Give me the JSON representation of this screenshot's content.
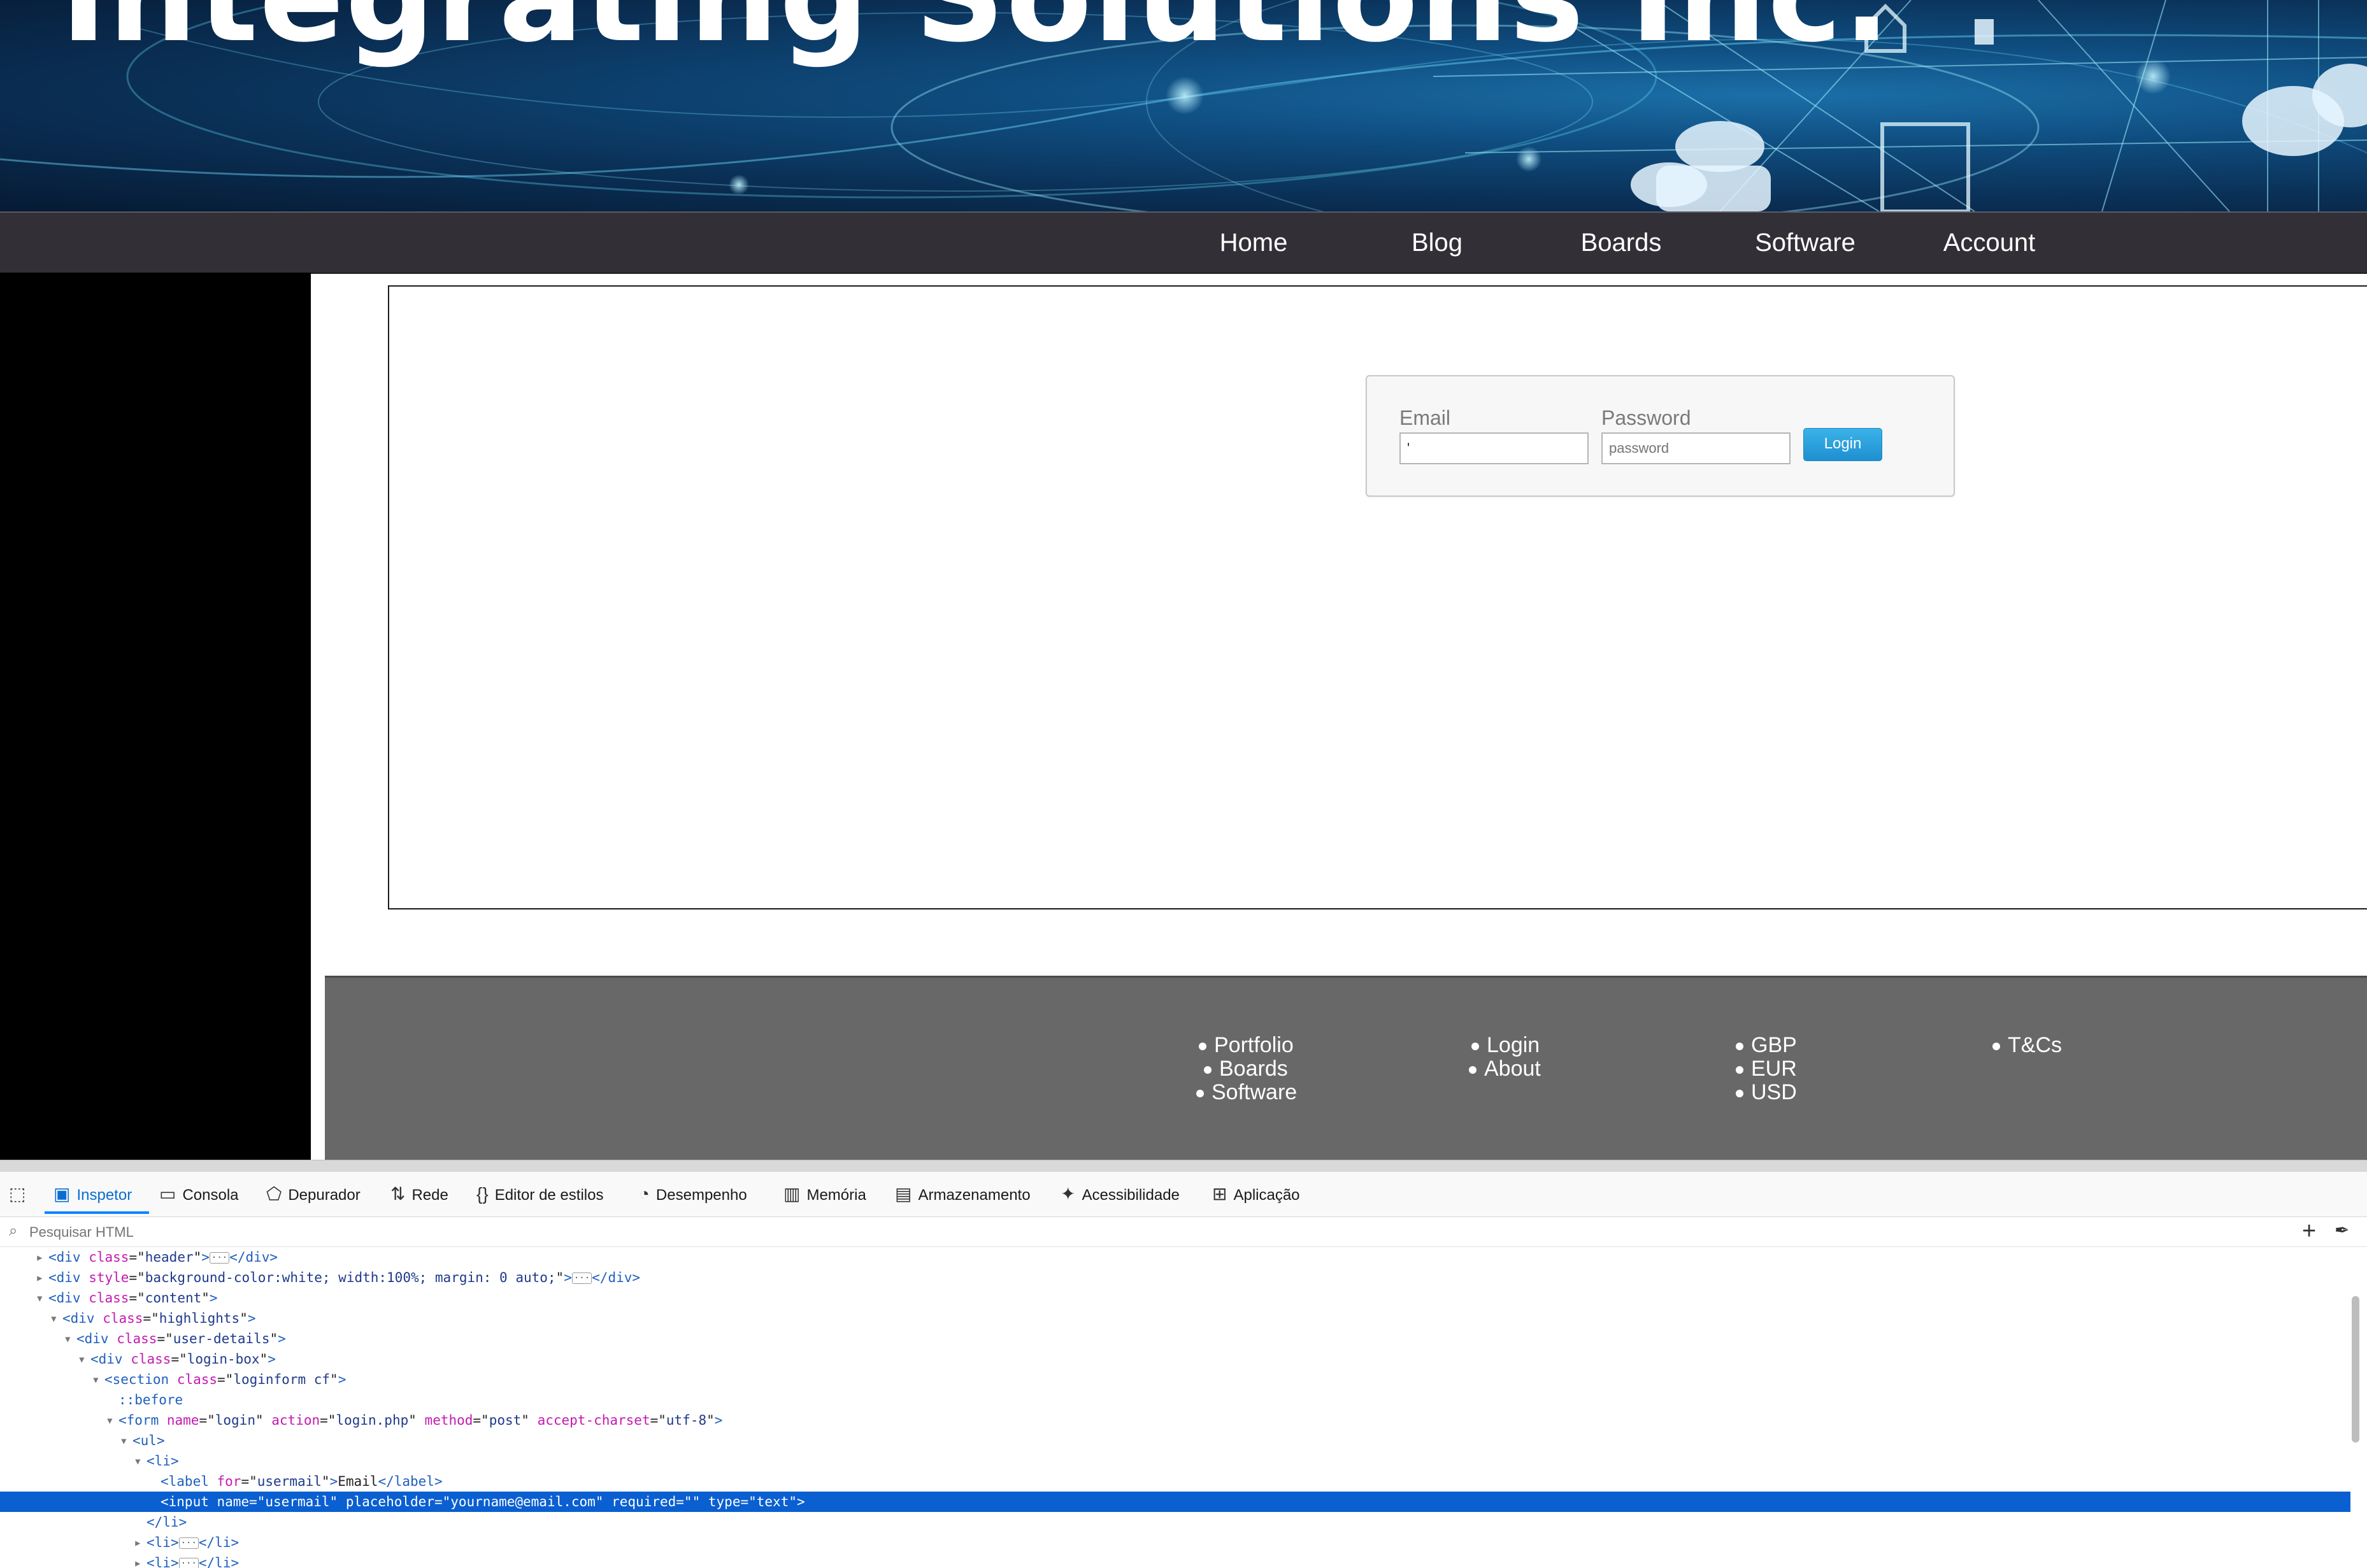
{
  "banner": {
    "title": "Integrating Solutions Inc."
  },
  "nav": {
    "items": [
      "Home",
      "Blog",
      "Boards",
      "Software",
      "Account"
    ]
  },
  "login": {
    "email_label": "Email",
    "email_value": "'",
    "password_label": "Password",
    "password_placeholder": "password",
    "button": "Login"
  },
  "footer": {
    "col1": [
      "Portfolio",
      "Boards",
      "Software"
    ],
    "col2": [
      "Login",
      "About"
    ],
    "col3": [
      "GBP",
      "EUR",
      "USD"
    ],
    "col4": [
      "T&Cs"
    ]
  },
  "devtools": {
    "tabs": [
      "Inspetor",
      "Consola",
      "Depurador",
      "Rede",
      "Editor de estilos",
      "Desempenho",
      "Memória",
      "Armazenamento",
      "Acessibilidade",
      "Aplicação"
    ],
    "search_placeholder": "Pesquisar HTML",
    "add_symbol": "+",
    "code": [
      {
        "indent": 0,
        "arrow": "▸",
        "tag": "div",
        "attrs": [
          [
            "class",
            "header"
          ]
        ],
        "collapsed": true
      },
      {
        "indent": 0,
        "arrow": "▸",
        "tag": "div",
        "attrs": [
          [
            "style",
            "background-color:white; width:100%; margin: 0 auto;"
          ]
        ],
        "collapsed": true
      },
      {
        "indent": 0,
        "arrow": "▾",
        "tag": "div",
        "attrs": [
          [
            "class",
            "content"
          ]
        ]
      },
      {
        "indent": 1,
        "arrow": "▾",
        "tag": "div",
        "attrs": [
          [
            "class",
            "highlights"
          ]
        ]
      },
      {
        "indent": 2,
        "arrow": "▾",
        "tag": "div",
        "attrs": [
          [
            "class",
            "user-details"
          ]
        ]
      },
      {
        "indent": 3,
        "arrow": "▾",
        "tag": "div",
        "attrs": [
          [
            "class",
            "login-box"
          ]
        ]
      },
      {
        "indent": 4,
        "arrow": "▾",
        "tag": "section",
        "attrs": [
          [
            "class",
            "loginform cf"
          ]
        ]
      },
      {
        "indent": 5,
        "arrow": "",
        "pseudo": "::before"
      },
      {
        "indent": 5,
        "arrow": "▾",
        "tag": "form",
        "attrs": [
          [
            "name",
            "login"
          ],
          [
            "action",
            "login.php"
          ],
          [
            "method",
            "post"
          ],
          [
            "accept-charset",
            "utf-8"
          ]
        ]
      },
      {
        "indent": 6,
        "arrow": "▾",
        "tag": "ul",
        "attrs": []
      },
      {
        "indent": 7,
        "arrow": "▾",
        "tag": "li",
        "attrs": []
      },
      {
        "indent": 8,
        "arrow": "",
        "tag": "label",
        "attrs": [
          [
            "for",
            "usermail"
          ]
        ],
        "text": "Email",
        "close": true
      },
      {
        "indent": 8,
        "arrow": "",
        "tag": "input",
        "attrs": [
          [
            "name",
            "usermail"
          ],
          [
            "placeholder",
            "yourname@email.com"
          ],
          [
            "required",
            ""
          ],
          [
            "type",
            "text"
          ]
        ],
        "selected": true
      },
      {
        "indent": 7,
        "arrow": "",
        "closing": "li"
      },
      {
        "indent": 7,
        "arrow": "▸",
        "tag": "li",
        "attrs": [],
        "collapsed": true
      },
      {
        "indent": 7,
        "arrow": "▸",
        "tag": "li",
        "attrs": [],
        "collapsed": true
      }
    ]
  },
  "colors": {
    "nav_bg": "#323036",
    "footer_bg": "#686868",
    "button": "#1e8fd0",
    "selection": "#0a5fd1"
  }
}
